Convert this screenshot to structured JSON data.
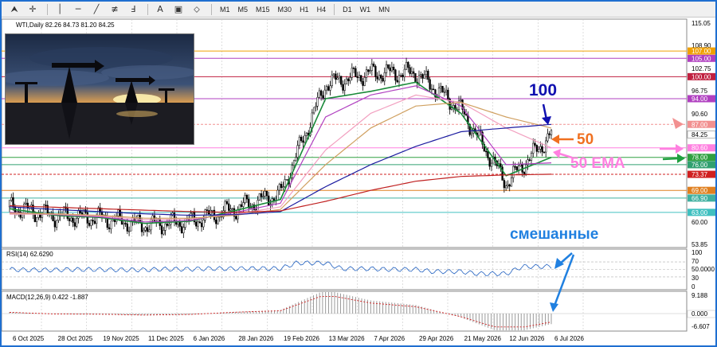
{
  "toolbar": {
    "timeframes": [
      "M1",
      "M5",
      "M15",
      "M30",
      "H1",
      "H4",
      "D1",
      "W1",
      "MN"
    ]
  },
  "header": {
    "symbol_line": "WTI,Daily  82.26 84.73 81.20 84.25"
  },
  "price_axis": {
    "ticks": [
      "115.05",
      "108.90",
      "102.75",
      "96.75",
      "90.60",
      "60.00",
      "53.85"
    ],
    "badges": [
      {
        "value": "107.00",
        "color": "#f0a000"
      },
      {
        "value": "105.00",
        "color": "#b040c0"
      },
      {
        "value": "100.00",
        "color": "#c02040"
      },
      {
        "value": "94.00",
        "color": "#b040c0"
      },
      {
        "value": "87.00",
        "color": "#f29090"
      },
      {
        "value": "84.25",
        "color": "#ffffff"
      },
      {
        "value": "80.60",
        "color": "#ff80e0"
      },
      {
        "value": "78.00",
        "color": "#30a040"
      },
      {
        "value": "76.00",
        "color": "#30a070"
      },
      {
        "value": "73.37",
        "color": "#d02020"
      },
      {
        "value": "69.00",
        "color": "#e08020"
      },
      {
        "value": "66.90",
        "color": "#40b0a0"
      },
      {
        "value": "63.00",
        "color": "#40c0c0"
      }
    ]
  },
  "annotations": {
    "ma100": "100",
    "ma50": "50",
    "ema50": "50 EMA",
    "mixed": "смешанные"
  },
  "rsi": {
    "label": "RSI(14) 62.6290",
    "ticks": [
      "100",
      "70",
      "50.0000",
      "30",
      "0"
    ]
  },
  "macd": {
    "label": "MACD(12,26,9) 0.422 -1.887",
    "ticks": [
      "9.188",
      "0.000",
      "-6.607"
    ]
  },
  "date_axis": [
    "6 Oct 2025",
    "28 Oct 2025",
    "19 Nov 2025",
    "11 Dec 2025",
    "6 Jan 2026",
    "28 Jan 2026",
    "19 Feb 2026",
    "13 Mar 2026",
    "7 Apr 2026",
    "29 Apr 2026",
    "21 May 2026",
    "12 Jun 2026",
    "6 Jul 2026"
  ],
  "chart_data": {
    "type": "line",
    "title": "WTI,Daily",
    "price_range": [
      53.85,
      115.05
    ],
    "levels": [
      107.0,
      105.0,
      100.0,
      94.0,
      87.0,
      80.6,
      78.0,
      76.0,
      73.37,
      69.0,
      66.9,
      63.0
    ],
    "x": [
      "6 Oct 2025",
      "28 Oct 2025",
      "19 Nov 2025",
      "11 Dec 2025",
      "6 Jan 2026",
      "28 Jan 2026",
      "19 Feb 2026",
      "13 Mar 2026",
      "7 Apr 2026",
      "29 Apr 2026",
      "21 May 2026",
      "12 Jun 2026",
      "6 Jul 2026"
    ],
    "series": [
      {
        "name": "",
        "color": "#000000",
        "values": [
          64.5,
          62.0,
          61.5,
          59.5,
          60.5,
          64.0,
          68.0,
          98.0,
          101.0,
          101.0,
          91.0,
          71.0,
          84.25
        ]
      }
    ],
    "ma_lines": [
      {
        "color": "#1a8a3a",
        "values": [
          64.0,
          62.2,
          61.6,
          60.0,
          60.6,
          63.5,
          66.5,
          94.0,
          96.0,
          98.5,
          90.0,
          73.0,
          78.0
        ]
      },
      {
        "color": "#b040c0",
        "values": [
          63.0,
          62.4,
          61.8,
          60.4,
          60.8,
          63.0,
          65.5,
          89.0,
          95.0,
          97.5,
          92.0,
          76.0,
          76.5
        ]
      },
      {
        "color": "#f2a0c0",
        "values": [
          62.5,
          62.5,
          62.0,
          61.0,
          61.2,
          62.5,
          64.5,
          80.0,
          90.0,
          95.0,
          93.0,
          86.0,
          80.6
        ]
      },
      {
        "color": "#d0a060",
        "values": [
          62.8,
          62.6,
          62.2,
          61.4,
          61.4,
          62.2,
          63.8,
          76.0,
          86.0,
          92.0,
          93.0,
          89.0,
          86.0
        ]
      },
      {
        "color": "#1c1ca0",
        "values": [
          64.5,
          63.8,
          63.2,
          62.6,
          62.2,
          62.4,
          63.2,
          70.0,
          76.0,
          81.0,
          85.0,
          86.0,
          87.0
        ]
      },
      {
        "color": "#c02020",
        "values": [
          64.8,
          64.4,
          64.0,
          63.6,
          63.2,
          63.0,
          63.4,
          66.0,
          69.0,
          71.5,
          72.8,
          73.2,
          73.4
        ]
      }
    ]
  }
}
